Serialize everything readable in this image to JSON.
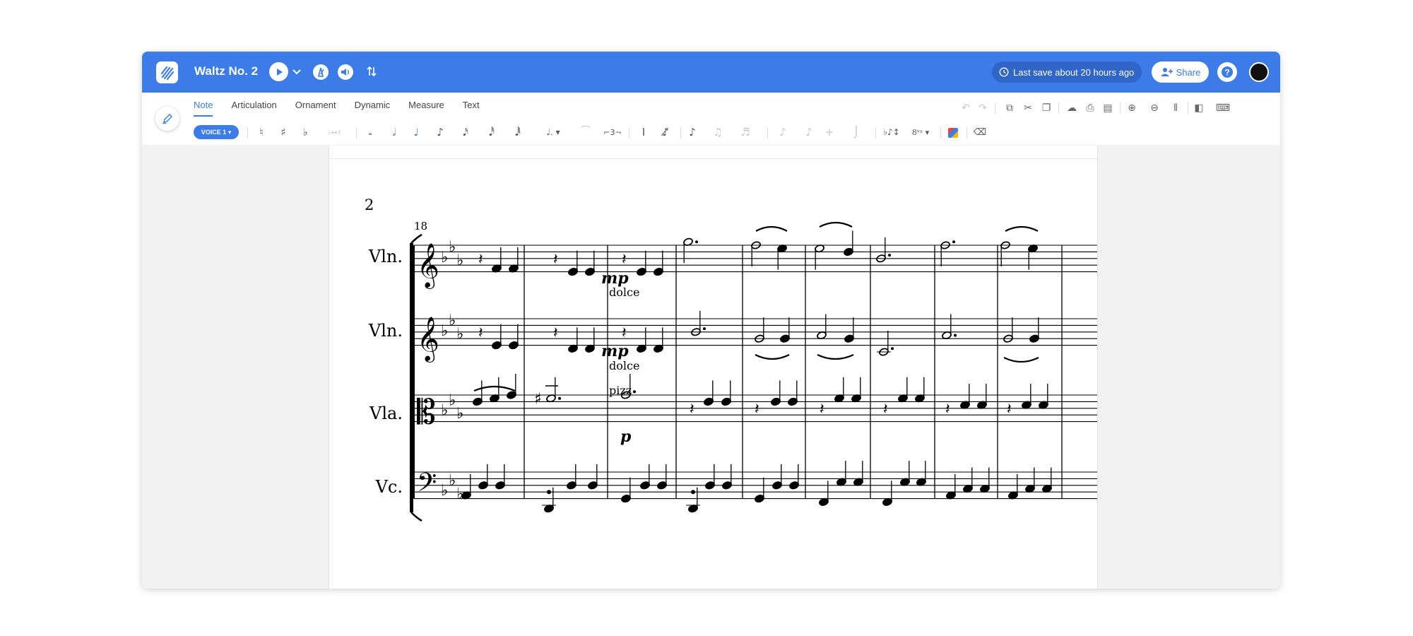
{
  "app": {
    "title": "Waltz No. 2",
    "save_status": "Last save about 20 hours ago",
    "share_label": "Share"
  },
  "tabs": [
    "Note",
    "Articulation",
    "Ornament",
    "Dynamic",
    "Measure",
    "Text"
  ],
  "active_tab": "Note",
  "voice_label": "VOICE 1",
  "accent_color": "#3b7ce8",
  "score": {
    "page_number": "2",
    "measure_number": "18",
    "staves": [
      {
        "name": "Vln.",
        "clef": "treble"
      },
      {
        "name": "Vln.",
        "clef": "treble"
      },
      {
        "name": "Vla.",
        "clef": "alto"
      },
      {
        "name": "Vc.",
        "clef": "bass"
      }
    ],
    "key_signature": "3 flats",
    "markings": {
      "mp": "mp",
      "dolce": "dolce",
      "pizz": "pizz",
      "p": "p"
    }
  },
  "icons": {
    "toolbar_top": [
      "undo-icon",
      "redo-icon",
      "copy-icon",
      "cut-icon",
      "duplicate-icon",
      "cloud-icon",
      "print-icon",
      "layout-icon",
      "zoom-in-icon",
      "zoom-out-icon",
      "barlines-icon",
      "parts-icon",
      "keyboard-icon"
    ],
    "note_toolbar": [
      "natural-icon",
      "sharp-icon",
      "flat-icon",
      "respell-icon",
      "whole-note-icon",
      "half-note-icon",
      "quarter-note-icon",
      "eighth-note-icon",
      "sixteenth-note-icon",
      "32nd-note-icon",
      "64th-note-icon",
      "dotted-note-icon",
      "tie-icon",
      "tuplet-icon",
      "cursor-icon",
      "slash-note-icon",
      "grace-note-icon",
      "beam-icon",
      "beam2-icon",
      "stem-icon",
      "stem2-icon",
      "tie2-icon",
      "slur-icon",
      "pitch-flip-icon",
      "ottava-icon",
      "color-icon",
      "delete-icon"
    ]
  }
}
